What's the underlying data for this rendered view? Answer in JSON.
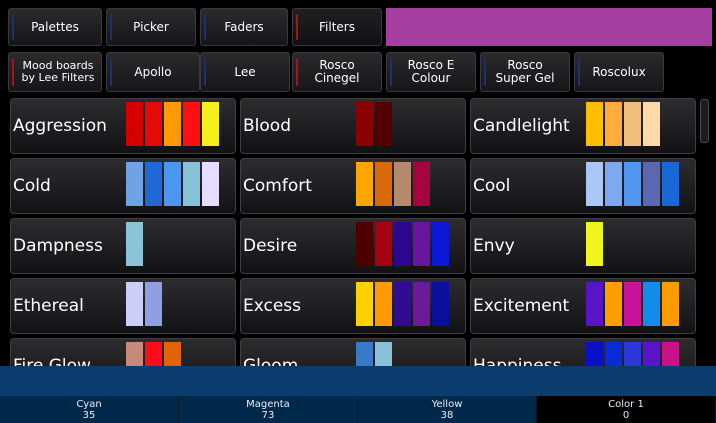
{
  "tabs": [
    {
      "label": "Palettes"
    },
    {
      "label": "Picker"
    },
    {
      "label": "Faders"
    },
    {
      "label": "Filters"
    }
  ],
  "current_color": "#a53e9e",
  "libraries": [
    {
      "label": "Mood boards by Lee Filters"
    },
    {
      "label": "Apollo"
    },
    {
      "label": "Lee"
    },
    {
      "label": "Rosco Cinegel"
    },
    {
      "label": "Rosco E Colour"
    },
    {
      "label": "Rosco Super Gel"
    },
    {
      "label": "Roscolux"
    }
  ],
  "moods": [
    {
      "name": "Aggression",
      "colors": [
        "#d60000",
        "#e40a0a",
        "#ff9a00",
        "#ff1010",
        "#f5f01c"
      ]
    },
    {
      "name": "Blood",
      "colors": [
        "#8a0303",
        "#540000"
      ]
    },
    {
      "name": "Candlelight",
      "colors": [
        "#ffbf00",
        "#ffab3d",
        "#f3bd7c",
        "#ffd8a8"
      ]
    },
    {
      "name": "Cold",
      "colors": [
        "#6fa3e6",
        "#1f68d6",
        "#4b97f0",
        "#88c2d8",
        "#e6dcff"
      ]
    },
    {
      "name": "Comfort",
      "colors": [
        "#ffa500",
        "#d9690a",
        "#b48a6e",
        "#a4053d"
      ]
    },
    {
      "name": "Cool",
      "colors": [
        "#a9c8f5",
        "#7ea9ee",
        "#5296f2",
        "#5b68b0",
        "#1868d8"
      ]
    },
    {
      "name": "Dampness",
      "colors": [
        "#8ac4d6"
      ]
    },
    {
      "name": "Desire",
      "colors": [
        "#4e0000",
        "#a4000f",
        "#2d0690",
        "#68169e",
        "#0a1ad6"
      ]
    },
    {
      "name": "Envy",
      "colors": [
        "#f0f51c"
      ]
    },
    {
      "name": "Ethereal",
      "colors": [
        "#cdcdf5",
        "#8e9fe3"
      ]
    },
    {
      "name": "Excess",
      "colors": [
        "#ffd000",
        "#ff9a00",
        "#310c8f",
        "#6c1a98",
        "#0a0fa0"
      ]
    },
    {
      "name": "Excitement",
      "colors": [
        "#5a14c8",
        "#ff9e00",
        "#c8129b",
        "#138be8",
        "#ff9a00"
      ]
    },
    {
      "name": "Fire Glow",
      "colors": [
        "#c8887a",
        "#ff0c1a",
        "#e0650a"
      ]
    },
    {
      "name": "Gloom",
      "colors": [
        "#3a78c8",
        "#8ac0d8"
      ]
    },
    {
      "name": "Happiness",
      "colors": [
        "#0a10c8",
        "#0a2ad8",
        "#2d36d8",
        "#5a14c8",
        "#c8128a"
      ]
    }
  ],
  "params": [
    {
      "label": "Cyan",
      "value": "35"
    },
    {
      "label": "Magenta",
      "value": "73"
    },
    {
      "label": "Yellow",
      "value": "38"
    },
    {
      "label": "Color 1",
      "value": "0"
    }
  ]
}
